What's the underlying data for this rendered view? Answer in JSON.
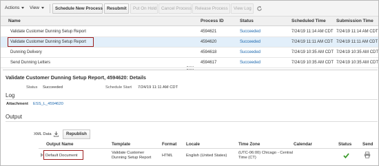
{
  "toolbar": {
    "actions_label": "Actions",
    "view_label": "View",
    "buttons": {
      "schedule_new": "Schedule New Process",
      "resubmit": "Resubmit",
      "put_on_hold": "Put On Hold",
      "cancel_process": "Cancel Process",
      "release_process": "Release Process",
      "view_log": "View Log"
    }
  },
  "grid": {
    "columns": {
      "name": "Name",
      "process_id": "Process ID",
      "status": "Status",
      "scheduled_time": "Scheduled Time",
      "submission_time": "Submission Time"
    },
    "rows": [
      {
        "name": "Validate Customer Dunning Setup Report",
        "process_id": "4594621",
        "status": "Succeeded",
        "scheduled_time": "7/24/19 11:14 AM CDT",
        "submission_time": "7/24/19 11:14 AM CDT"
      },
      {
        "name": "Validate Customer Dunning Setup Report",
        "process_id": "4594620",
        "status": "Succeeded",
        "scheduled_time": "7/24/19 11:11 AM CDT",
        "submission_time": "7/24/19 11:11 AM CDT"
      },
      {
        "name": "Dunning Delivery",
        "process_id": "4594618",
        "status": "Succeeded",
        "scheduled_time": "7/24/19 10:35 AM CDT",
        "submission_time": "7/24/19 10:35 AM CDT"
      },
      {
        "name": "Send Dunning Letters",
        "process_id": "4594617",
        "status": "Succeeded",
        "scheduled_time": "7/24/19 10:35 AM CDT",
        "submission_time": "7/24/19 10:35 AM CDT"
      }
    ]
  },
  "details": {
    "title": "Validate Customer Dunning Setup Report, 4594620: Details",
    "status_label": "Status",
    "status_value": "Succeeded",
    "schedule_start_label": "Schedule Start",
    "schedule_start_value": "7/24/19 11:11 AM CDT",
    "log_heading": "Log",
    "attachment_label": "Attachment",
    "attachment_value": "ESS_L_4594620",
    "output_heading": "Output",
    "xml_data_label": "XML Data",
    "republish_label": "Republish",
    "output_table": {
      "columns": {
        "output_name": "Output Name",
        "template": "Template",
        "format": "Format",
        "locale": "Locale",
        "time_zone": "Time Zone",
        "calendar": "Calendar",
        "status": "Status",
        "send": "Send"
      },
      "row": {
        "output_name": "Default Document",
        "template": "Validate Customer Dunning Setup Report",
        "format": "HTML",
        "locale": "English (United States)",
        "time_zone": "(UTC-06:00) Chicago - Central Time (CT)",
        "calendar": "",
        "status_icon": "green-check-icon",
        "send_icon": "printer-icon"
      }
    }
  },
  "colors": {
    "link": "#1b67ad",
    "selected_row": "#e2effa",
    "callout": "#9b1c1c",
    "success": "#3a9a2a"
  }
}
